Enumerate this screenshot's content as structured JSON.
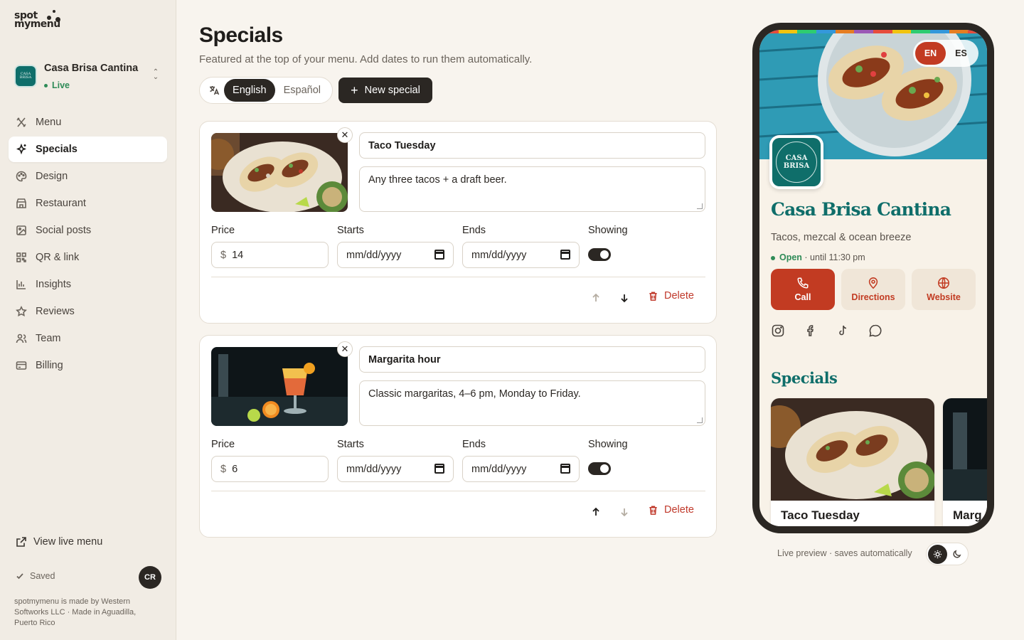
{
  "brand": {
    "logo_line1": "spot",
    "logo_line2": "mymenu"
  },
  "restaurant": {
    "name": "Casa Brisa Cantina",
    "status": "Live",
    "logo_text": "CASA BRISA"
  },
  "nav": [
    {
      "label": "Menu",
      "icon": "utensils-icon"
    },
    {
      "label": "Specials",
      "icon": "sparkles-icon",
      "active": true
    },
    {
      "label": "Design",
      "icon": "palette-icon"
    },
    {
      "label": "Restaurant",
      "icon": "store-icon"
    },
    {
      "label": "Social posts",
      "icon": "image-icon"
    },
    {
      "label": "QR & link",
      "icon": "qr-code-icon"
    },
    {
      "label": "Insights",
      "icon": "bar-chart-icon"
    },
    {
      "label": "Reviews",
      "icon": "star-icon"
    },
    {
      "label": "Team",
      "icon": "users-icon"
    },
    {
      "label": "Billing",
      "icon": "credit-card-icon"
    }
  ],
  "sidebar_footer": {
    "view_live": "View live menu",
    "saved": "Saved",
    "avatar_initials": "CR",
    "note": "spotmymenu is made by Western Softworks LLC · Made in Aguadilla, Puerto Rico"
  },
  "header": {
    "title": "Specials",
    "subtitle": "Featured at the top of your menu. Add dates to run them automatically.",
    "lang_options": [
      "English",
      "Español"
    ],
    "lang_selected": "English",
    "new_special": "New special"
  },
  "field_labels": {
    "price": "Price",
    "starts": "Starts",
    "ends": "Ends",
    "showing": "Showing",
    "delete": "Delete",
    "currency": "$",
    "date_placeholder": "mm/dd/yyyy"
  },
  "specials": [
    {
      "title": "Taco Tuesday",
      "description": "Any three tacos + a draft beer.",
      "price": "14",
      "starts": "mm/dd/yyyy",
      "ends": "mm/dd/yyyy",
      "showing": true
    },
    {
      "title": "Margarita hour",
      "description": "Classic margaritas, 4–6 pm, Monday to Friday.",
      "price": "6",
      "starts": "mm/dd/yyyy",
      "ends": "mm/dd/yyyy",
      "showing": true
    }
  ],
  "preview": {
    "lang_en": "EN",
    "lang_es": "ES",
    "name": "Casa Brisa Cantina",
    "tagline": "Tacos, mezcal & ocean breeze",
    "open_label": "Open",
    "open_until": " · until 11:30 pm",
    "actions": [
      "Call",
      "Directions",
      "Website"
    ],
    "specials_heading": "Specials",
    "special_cards": [
      "Taco Tuesday",
      "Marg"
    ],
    "caption": "Live preview · saves automatically"
  },
  "colors": {
    "accent": "#c23b22",
    "brand_teal": "#0f6e6a",
    "dark": "#2b2723",
    "live_green": "#2e8b57"
  }
}
